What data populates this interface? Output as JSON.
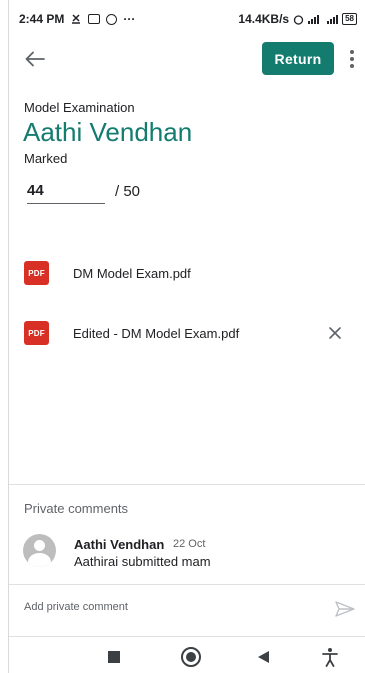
{
  "status_bar": {
    "time": "2:44 PM",
    "overflow": "···",
    "speed": "14.4KB/s",
    "battery": "58"
  },
  "app_bar": {
    "back_icon": "arrow-left-icon",
    "return_label": "Return",
    "more_icon": "more-vert-icon"
  },
  "submission": {
    "assignment_title": "Model Examination",
    "student_name": "Aathi Vendhan",
    "status": "Marked",
    "grade_value": "44",
    "grade_total": "/ 50"
  },
  "attachments": [
    {
      "icon": "pdf-icon",
      "icon_label": "PDF",
      "name": "DM Model Exam.pdf",
      "removable": false
    },
    {
      "icon": "pdf-icon",
      "icon_label": "PDF",
      "name": "Edited - DM Model Exam.pdf",
      "removable": true
    }
  ],
  "private_comments": {
    "heading": "Private comments",
    "comments": [
      {
        "author": "Aathi Vendhan",
        "date": "22 Oct",
        "text": "Aathirai submitted mam"
      }
    ],
    "input_placeholder": "Add private comment",
    "send_icon": "send-icon"
  },
  "nav_bar": {
    "icons": [
      "recents-icon",
      "home-icon",
      "back-icon",
      "accessibility-icon"
    ]
  },
  "colors": {
    "accent": "#137c6f",
    "pdf": "#d93025"
  }
}
